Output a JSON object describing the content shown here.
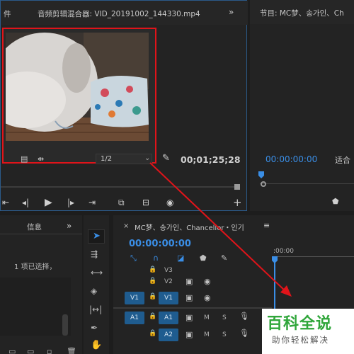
{
  "source": {
    "tab_fragment": "件",
    "title": "音频剪辑混合器: VID_20191002_144330.mp4",
    "menu_icon": "double-chevron-icon",
    "zoom": "1/2",
    "timecode": "00;01;25;28",
    "transport": [
      "mark-in-icon",
      "step-back-icon",
      "play-icon",
      "step-forward-icon",
      "go-out-icon",
      "insert-icon",
      "overwrite-icon",
      "camera-icon",
      "plus-icon"
    ]
  },
  "program": {
    "title": "节目: MC梦、송가인、Ch",
    "timecode": "00:00:00:00",
    "fit_label": "适合"
  },
  "info": {
    "title": "信息",
    "selection_text": "1 项已选择，"
  },
  "timeline": {
    "sequence_title": "MC梦、송가인、Chancellor・인기",
    "timecode": "00:00:00:00",
    "ruler_label": ":00:00",
    "tracks": [
      {
        "name": "V3",
        "src": "",
        "dst": ""
      },
      {
        "name": "V2",
        "src": "",
        "dst": ""
      },
      {
        "name": "V1",
        "src": "V1",
        "dst": "V1"
      },
      {
        "name": "A1",
        "src": "A1",
        "dst": "A1"
      },
      {
        "name": "A2",
        "src": "",
        "dst": "A2"
      }
    ],
    "m_label": "M",
    "s_label": "S"
  },
  "watermark": {
    "title": "百科全说",
    "subtitle": "助你轻松解决"
  },
  "colors": {
    "highlight_red": "#e0141a",
    "accent_blue": "#3a8ee6",
    "track_blue": "#1f5c8f",
    "brand_green": "#2fa63a"
  }
}
